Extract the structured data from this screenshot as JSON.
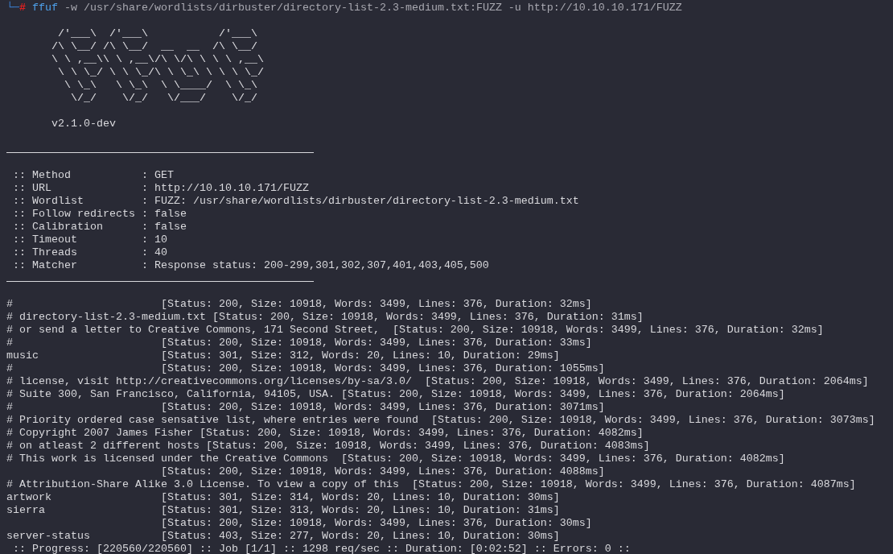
{
  "prompt": {
    "prefix": "└─",
    "symbol": "#",
    "command": "ffuf",
    "args": "-w /usr/share/wordlists/dirbuster/directory-list-2.3-medium.txt:FUZZ -u http://10.10.10.171/FUZZ"
  },
  "banner": [
    "        /'___\\  /'___\\           /'___\\",
    "       /\\ \\__/ /\\ \\__/  __  __  /\\ \\__/",
    "       \\ \\ ,__\\\\ \\ ,__\\/\\ \\/\\ \\ \\ \\ ,__\\",
    "        \\ \\ \\_/ \\ \\ \\_/\\ \\ \\_\\ \\ \\ \\ \\_/",
    "         \\ \\_\\   \\ \\_\\  \\ \\____/  \\ \\_\\",
    "          \\/_/    \\/_/   \\/___/    \\/_/"
  ],
  "version": "       v2.1.0-dev",
  "config": [
    " :: Method           : GET",
    " :: URL              : http://10.10.10.171/FUZZ",
    " :: Wordlist         : FUZZ: /usr/share/wordlists/dirbuster/directory-list-2.3-medium.txt",
    " :: Follow redirects : false",
    " :: Calibration      : false",
    " :: Timeout          : 10",
    " :: Threads          : 40",
    " :: Matcher          : Response status: 200-299,301,302,307,401,403,405,500"
  ],
  "results": [
    "#                       [Status: 200, Size: 10918, Words: 3499, Lines: 376, Duration: 32ms]",
    "# directory-list-2.3-medium.txt [Status: 200, Size: 10918, Words: 3499, Lines: 376, Duration: 31ms]",
    "# or send a letter to Creative Commons, 171 Second Street,  [Status: 200, Size: 10918, Words: 3499, Lines: 376, Duration: 32ms]",
    "#                       [Status: 200, Size: 10918, Words: 3499, Lines: 376, Duration: 33ms]",
    "music                   [Status: 301, Size: 312, Words: 20, Lines: 10, Duration: 29ms]",
    "#                       [Status: 200, Size: 10918, Words: 3499, Lines: 376, Duration: 1055ms]",
    "# license, visit http://creativecommons.org/licenses/by-sa/3.0/  [Status: 200, Size: 10918, Words: 3499, Lines: 376, Duration: 2064ms]",
    "# Suite 300, San Francisco, California, 94105, USA. [Status: 200, Size: 10918, Words: 3499, Lines: 376, Duration: 2064ms]",
    "#                       [Status: 200, Size: 10918, Words: 3499, Lines: 376, Duration: 3071ms]",
    "# Priority ordered case sensative list, where entries were found  [Status: 200, Size: 10918, Words: 3499, Lines: 376, Duration: 3073ms]",
    "# Copyright 2007 James Fisher [Status: 200, Size: 10918, Words: 3499, Lines: 376, Duration: 4082ms]",
    "# on atleast 2 different hosts [Status: 200, Size: 10918, Words: 3499, Lines: 376, Duration: 4083ms]",
    "# This work is licensed under the Creative Commons  [Status: 200, Size: 10918, Words: 3499, Lines: 376, Duration: 4082ms]",
    "                        [Status: 200, Size: 10918, Words: 3499, Lines: 376, Duration: 4088ms]",
    "# Attribution-Share Alike 3.0 License. To view a copy of this  [Status: 200, Size: 10918, Words: 3499, Lines: 376, Duration: 4087ms]",
    "artwork                 [Status: 301, Size: 314, Words: 20, Lines: 10, Duration: 30ms]",
    "sierra                  [Status: 301, Size: 313, Words: 20, Lines: 10, Duration: 31ms]",
    "                        [Status: 200, Size: 10918, Words: 3499, Lines: 376, Duration: 30ms]",
    "server-status           [Status: 403, Size: 277, Words: 20, Lines: 10, Duration: 30ms]"
  ],
  "progress": ":: Progress: [220560/220560] :: Job [1/1] :: 1298 req/sec :: Duration: [0:02:52] :: Errors: 0 ::"
}
